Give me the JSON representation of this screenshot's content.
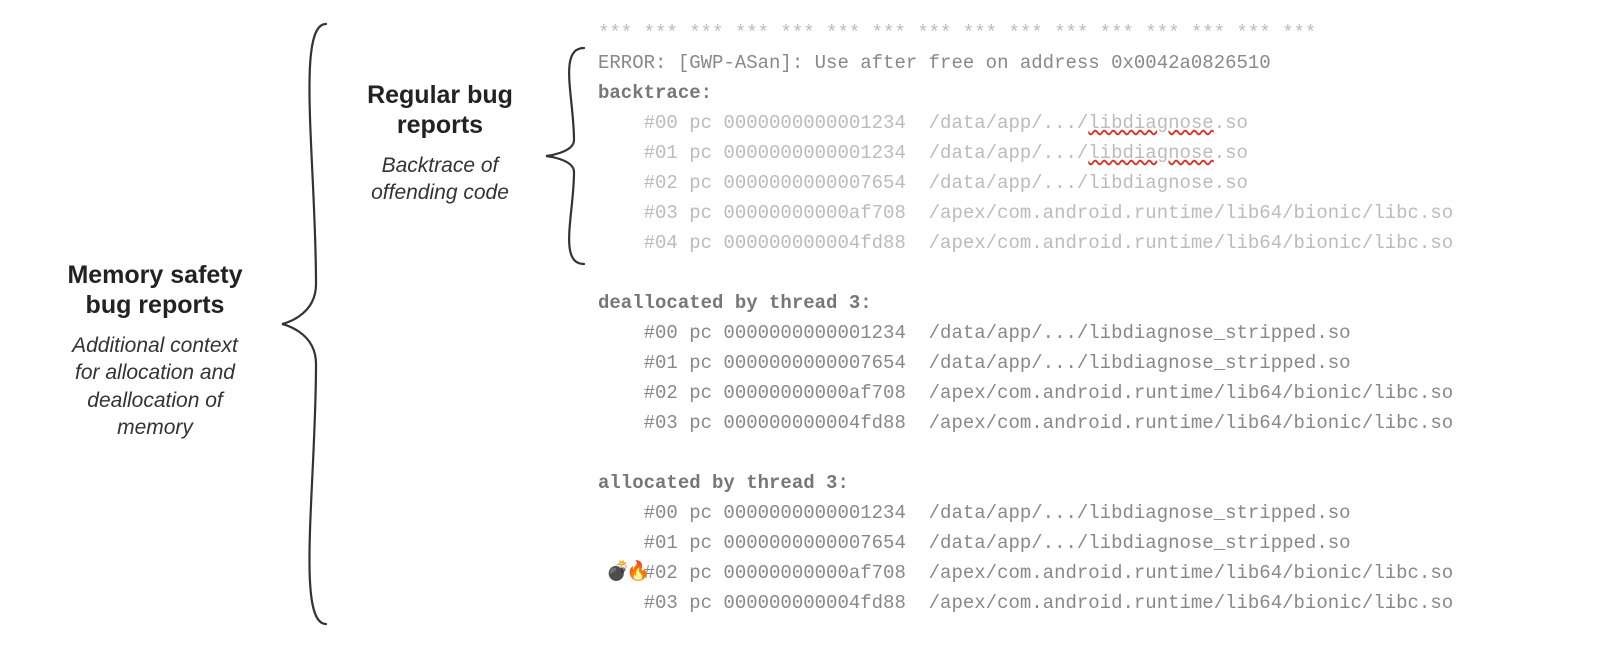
{
  "labels": {
    "outerTitle1": "Memory safety",
    "outerTitle2": "bug reports",
    "outerSub1": "Additional context",
    "outerSub2": "for allocation and",
    "outerSub3": "deallocation of",
    "outerSub4": "memory",
    "innerTitle1": "Regular bug",
    "innerTitle2": "reports",
    "innerSub1": "Backtrace of",
    "innerSub2": "offending code"
  },
  "code": {
    "sep": "*** *** *** *** *** *** *** *** *** *** *** *** *** *** *** ***",
    "err": "ERROR: [GWP-ASan]: Use after free on address 0x0042a0826510",
    "bt": "backtrace:",
    "b0a": "    #00 pc 0000000000001234  /data/app/.../",
    "b0b": "libdiagnose",
    "b0c": ".so",
    "b1a": "    #01 pc 0000000000001234  /data/app/.../",
    "b1b": "libdiagnose",
    "b1c": ".so",
    "b2": "    #02 pc 0000000000007654  /data/app/.../libdiagnose.so",
    "b3": "    #03 pc 00000000000af708  /apex/com.android.runtime/lib64/bionic/libc.so",
    "b4": "    #04 pc 000000000004fd88  /apex/com.android.runtime/lib64/bionic/libc.so",
    "dehdr": "deallocated by thread 3:",
    "d0": "    #00 pc 0000000000001234  /data/app/.../libdiagnose_stripped.so",
    "d1": "    #01 pc 0000000000007654  /data/app/.../libdiagnose_stripped.so",
    "d2": "    #02 pc 00000000000af708  /apex/com.android.runtime/lib64/bionic/libc.so",
    "d3": "    #03 pc 000000000004fd88  /apex/com.android.runtime/lib64/bionic/libc.so",
    "alhdr": "allocated by thread 3:",
    "a0": "    #00 pc 0000000000001234  /data/app/.../libdiagnose_stripped.so",
    "a1pre": "    ",
    "a1rest": "#01 pc 0000000000007654  /data/app/.../libdiagnose_stripped.so",
    "a2": "    #02 pc 00000000000af708  /apex/com.android.runtime/lib64/bionic/libc.so",
    "a3": "    #03 pc 000000000004fd88  /apex/com.android.runtime/lib64/bionic/libc.so"
  },
  "emoji": {
    "bomb": "💣",
    "fire": "🔥"
  }
}
